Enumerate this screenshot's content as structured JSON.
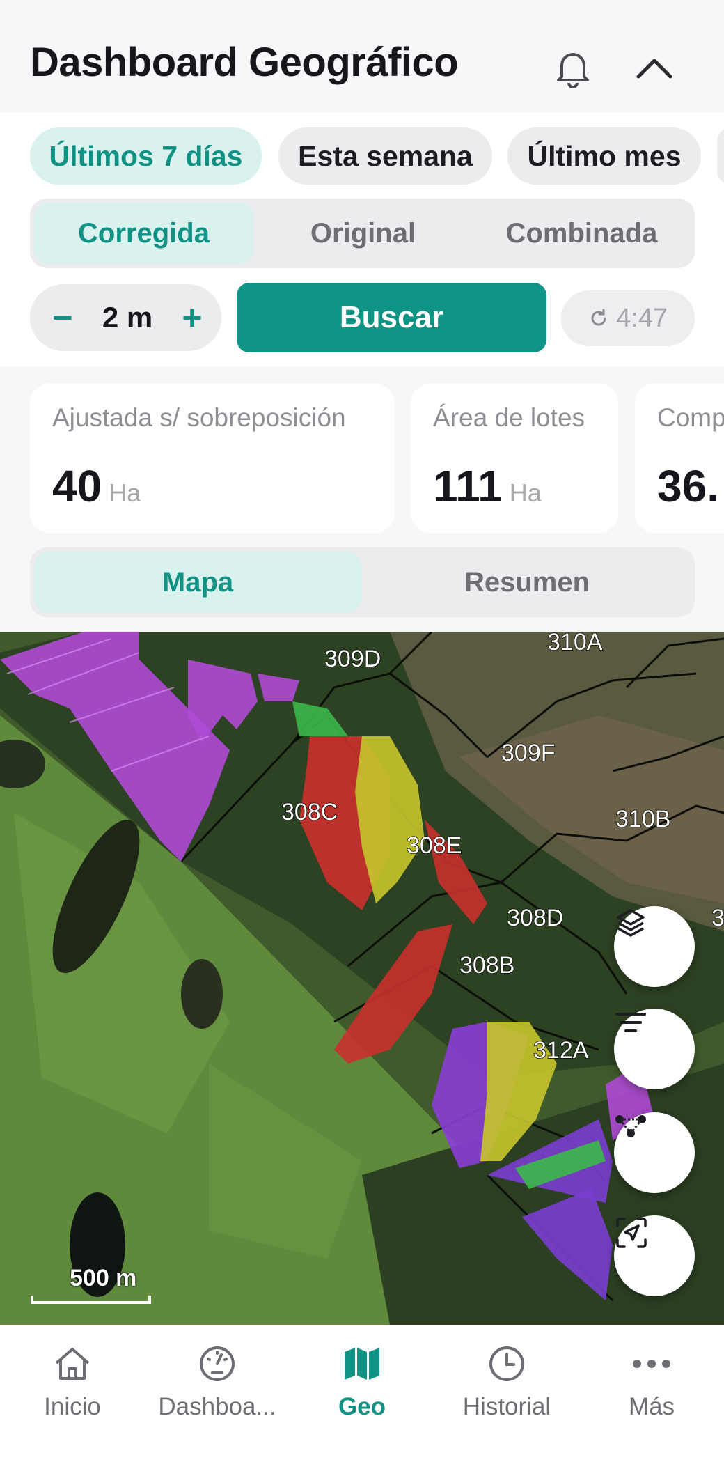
{
  "header": {
    "title": "Dashboard Geográfico",
    "icons": [
      "bell-icon",
      "chevron-up-icon"
    ]
  },
  "date_filters": [
    {
      "label": "Últimos 7 días",
      "active": true
    },
    {
      "label": "Esta semana",
      "active": false
    },
    {
      "label": "Último mes",
      "active": false
    }
  ],
  "view_mode": [
    {
      "label": "Corregida",
      "active": true
    },
    {
      "label": "Original",
      "active": false
    },
    {
      "label": "Combinada",
      "active": false
    }
  ],
  "stepper": {
    "minus": "−",
    "value": "2 m",
    "plus": "+"
  },
  "search_button": "Buscar",
  "timer": {
    "icon": "refresh-icon",
    "value": "4:47"
  },
  "stats": [
    {
      "label": "Ajustada s/ sobreposición",
      "value": "40",
      "unit": "Ha"
    },
    {
      "label": "Área de lotes",
      "value": "111",
      "unit": "Ha"
    },
    {
      "label": "Comp",
      "value": "36.",
      "unit": ""
    }
  ],
  "panel_tabs": [
    {
      "label": "Mapa",
      "active": true
    },
    {
      "label": "Resumen",
      "active": false
    }
  ],
  "map": {
    "lot_labels": [
      "309D",
      "310A",
      "309F",
      "308C",
      "310B",
      "308E",
      "308D",
      "308B",
      "312A",
      "3"
    ],
    "scale": "500 m",
    "fabs": [
      "layers-icon",
      "filter-lines-icon",
      "nodes-icon",
      "locate-icon"
    ],
    "colors": {
      "purple": "#b04ad6",
      "red": "#c9302c",
      "yellow": "#c4c22c",
      "green": "#3cb84a"
    }
  },
  "bottom_nav": [
    {
      "label": "Inicio",
      "icon": "home-icon",
      "active": false
    },
    {
      "label": "Dashboa...",
      "icon": "gauge-icon",
      "active": false
    },
    {
      "label": "Geo",
      "icon": "map-icon",
      "active": true
    },
    {
      "label": "Historial",
      "icon": "clock-icon",
      "active": false
    },
    {
      "label": "Más",
      "icon": "more-dots-icon",
      "active": false
    }
  ],
  "accent_color": "#0e9384"
}
